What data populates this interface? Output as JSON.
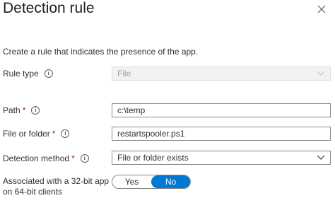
{
  "panel": {
    "title": "Detection rule",
    "close_icon": "close-icon"
  },
  "description": "Create a rule that indicates the presence of the app.",
  "fields": {
    "rule_type": {
      "label": "Rule type",
      "value": "File",
      "required": false
    },
    "path": {
      "label": "Path",
      "value": "c:\\temp",
      "required": true
    },
    "file_or_folder": {
      "label": "File or folder",
      "value": "restartspooler.ps1",
      "required": true
    },
    "detection_method": {
      "label": "Detection method",
      "value": "File or folder exists",
      "required": true
    }
  },
  "associated_32bit": {
    "label_line1": "Associated with a 32-bit app",
    "label_line2": "on 64-bit clients",
    "options": [
      "Yes",
      "No"
    ],
    "selected": "No"
  },
  "required_mark": "*",
  "info_glyph": "i",
  "colors": {
    "accent": "#0078d4",
    "required": "#a4262c",
    "disabled_bg": "#f3f2f1"
  }
}
